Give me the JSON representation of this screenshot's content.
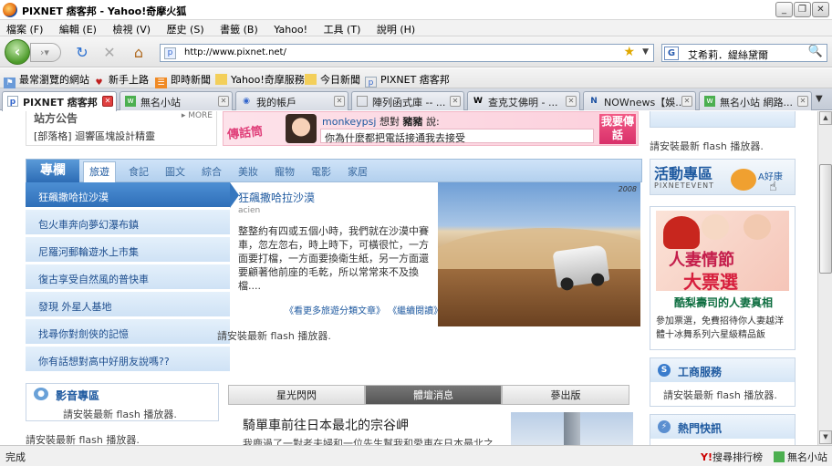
{
  "window": {
    "title": "PIXNET 痞客邦 - Yahoo!奇摩火狐"
  },
  "menu": [
    "檔案 (F)",
    "編輯 (E)",
    "檢視 (V)",
    "歷史 (S)",
    "書籤 (B)",
    "Yahoo!",
    "工具 (T)",
    "說明 (H)"
  ],
  "nav": {
    "url": "http://www.pixnet.net/",
    "search_value": "艾希莉．緹絲黛爾"
  },
  "bookmarks": [
    "最常瀏覽的網站",
    "新手上路",
    "即時新聞",
    "Yahoo!奇摩服務",
    "今日新聞",
    "PIXNET 痞客邦"
  ],
  "tabs": [
    "PIXNET 痞客邦",
    "無名小站",
    "我的帳戶",
    "陣列函式庫 -- ...",
    "查克艾佛明 - ...",
    "NOWnews【娛...",
    "無名小站 網路..."
  ],
  "page": {
    "announce_title": "站方公告",
    "announce_more": "MORE",
    "announce_text": "[部落格] 迴響區塊設計精靈",
    "bubble_label": "傳話筒",
    "bubble_user": "monkeypsj",
    "bubble_said": "想對",
    "bubble_target": "豬豬",
    "bubble_say": "說:",
    "bubble_text": "你為什麼都把電話接通我去接受",
    "bubble_btn": "我要傳話",
    "section_label": "專欄",
    "cats": [
      "旅遊",
      "食記",
      "圖文",
      "綜合",
      "美妝",
      "寵物",
      "電影",
      "家居"
    ],
    "side_items": [
      "狂飆撒哈拉沙漠",
      "包火車奔向夢幻瀑布鎮",
      "尼羅河郵輪遊水上市集",
      "復古享受自然風的普快車",
      "發現 外星人基地",
      "找尋你對劍俠的記憶",
      "你有話想對高中好朋友說嗎??"
    ],
    "article_title": "狂飆撒哈拉沙漠",
    "article_author": "acien",
    "article_body": "整整約有四或五個小時，我們就在沙漠中賽車，忽左忽右，時上時下，可橫很忙，一方面要打檔，一方面要換衛生紙，另一方面還要顧著他前座的毛乾，所以常常來不及換檔....",
    "article_more": "《看更多旅遊分類文章》",
    "article_continue": "《繼續閱讀》",
    "photo_year": "2008",
    "flash_msg": "請安裝最新 flash 播放器.",
    "video_title": "影音專區",
    "tabs3": [
      "星光閃閃",
      "體壇消息",
      "蔘出版"
    ],
    "news_title": "騎單車前往日本最北的宗谷岬",
    "news_text": "我鹿過了一對老夫婦和一位先生幫我和愛車在日本最北之",
    "right_event_title": "活動專區",
    "right_event_sub": "PIXNETEVENT",
    "right_event_badge": "A好康",
    "right_promo_line1": "人妻情節",
    "right_promo_line2": "大票選",
    "right_promo_caption": "酷梨壽司的人妻真相",
    "right_promo_text": "參加票選，免費招待你人妻越洋體十冰舞系列六星級精品飯",
    "right_biz": "工商服務",
    "right_hot": "熱門快訊"
  },
  "status": {
    "left": "完成",
    "yahoo": "搜尋排行榜",
    "wretch": "無名小站"
  }
}
